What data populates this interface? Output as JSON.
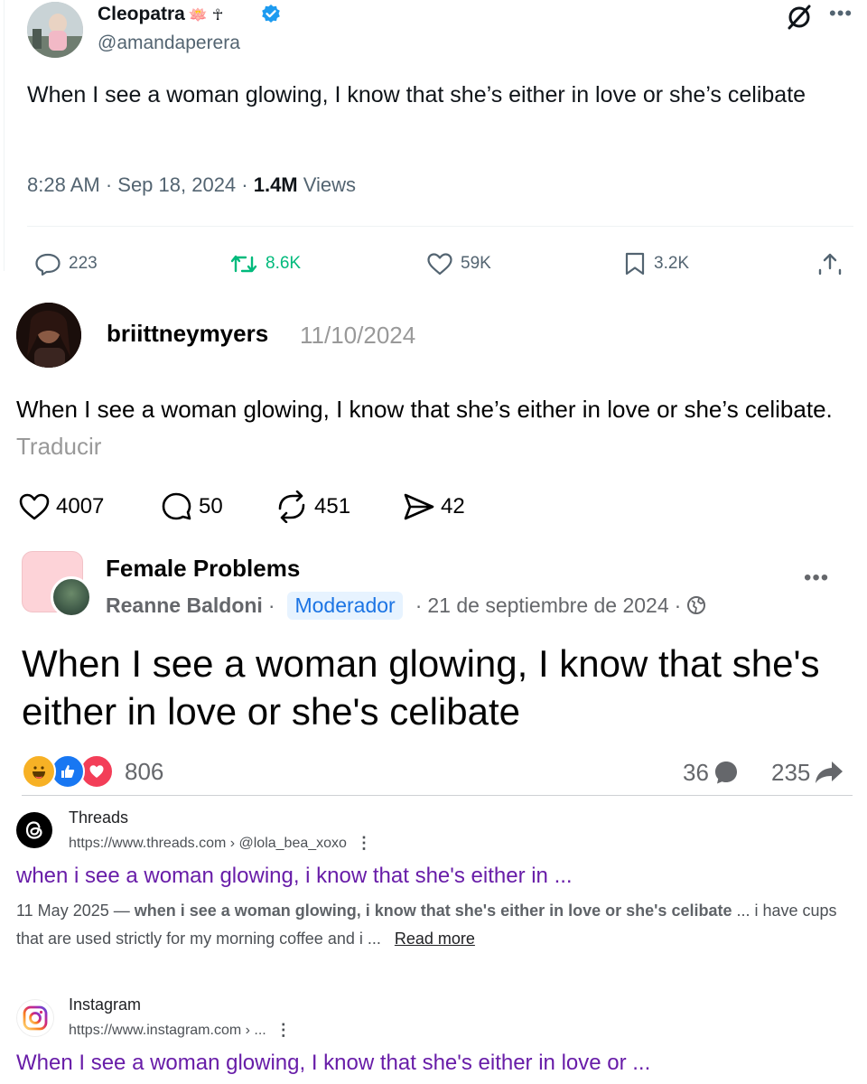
{
  "twitter": {
    "name": "Cleopatra",
    "name_emoji": "🪷 ☥",
    "handle": "@amandaperera",
    "text": "When I see a woman glowing, I know that she’s either in love or she’s celibate",
    "time_date": "8:28 AM · Sep 18, 2024 · ",
    "views_count": "1.4M",
    "views_label": " Views",
    "replies": "223",
    "reposts": "8.6K",
    "likes": "59K",
    "bookmarks": "3.2K",
    "colors": {
      "repost": "#00ba7c",
      "verified": "#1d9bf0",
      "muted": "#536471"
    }
  },
  "threads": {
    "username": "briittneymyers",
    "date": "11/10/2024",
    "text": "When I see a woman glowing, I know that she’s either in love or she’s celibate.",
    "translate": "Traducir",
    "likes": "4007",
    "replies": "50",
    "reposts": "451",
    "shares": "42"
  },
  "facebook": {
    "group_name": "Female Problems",
    "author": "Reanne Baldoni",
    "dot": "·",
    "badge": "Moderador",
    "date": "21 de septiembre de 2024",
    "text": "When I see a woman glowing, I know that she's either in love or she's celibate",
    "reactions_count": "806",
    "comments_count": "36",
    "shares_count": "235",
    "colors": {
      "like": "#1877f2",
      "love": "#f33e58",
      "haha": "#f7b125",
      "badge_bg": "#e7f3ff",
      "badge_text": "#1b74e4"
    }
  },
  "google": {
    "results": [
      {
        "site": "Threads",
        "url": "https://www.threads.com › @lola_bea_xoxo",
        "title": "when i see a woman glowing, i know that she's either in ...",
        "date": "11 May 2025 — ",
        "snippet_bold": "when i see a woman glowing, i know that she's either in love or she's celibate",
        "snippet_rest": " ... i have cups that are used strictly for my morning coffee and i ... ",
        "read_more": "Read more"
      },
      {
        "site": "Instagram",
        "url": "https://www.instagram.com › ...",
        "title": "When I see a woman glowing, I know that she's either in love or ..."
      }
    ],
    "menu_glyph": "⋮",
    "colors": {
      "visited_link": "#681da8"
    }
  }
}
